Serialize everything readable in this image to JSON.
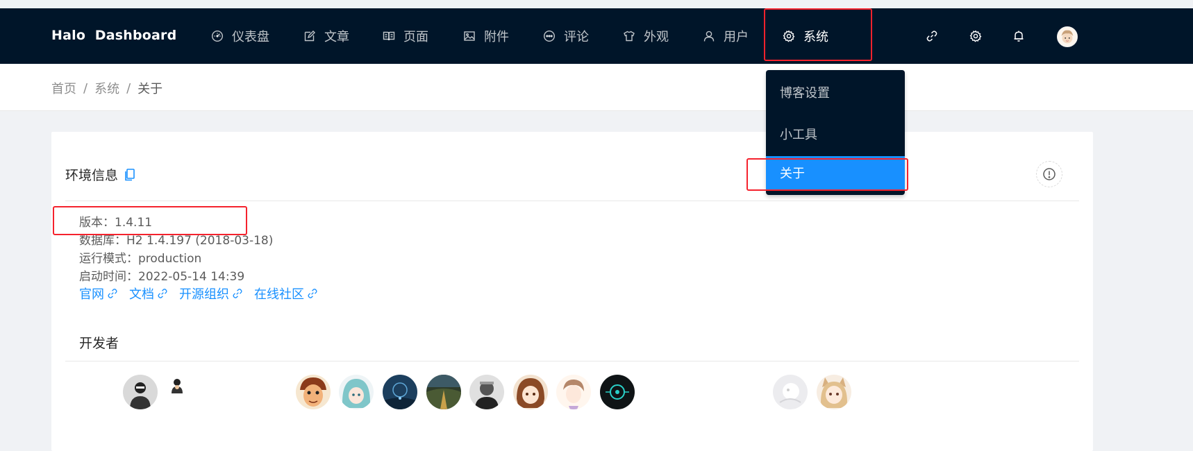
{
  "app": {
    "brand": "Halo  Dashboard"
  },
  "nav": {
    "items": [
      {
        "label": "仪表盘",
        "icon": "dashboard-icon"
      },
      {
        "label": "文章",
        "icon": "edit-icon"
      },
      {
        "label": "页面",
        "icon": "read-icon"
      },
      {
        "label": "附件",
        "icon": "picture-icon"
      },
      {
        "label": "评论",
        "icon": "message-icon"
      },
      {
        "label": "外观",
        "icon": "skin-icon"
      },
      {
        "label": "用户",
        "icon": "user-icon"
      },
      {
        "label": "系统",
        "icon": "setting-icon",
        "active": true
      }
    ],
    "right_icons": [
      "link-icon",
      "setting-icon",
      "bell-icon",
      "avatar"
    ]
  },
  "breadcrumb": {
    "items": [
      "首页",
      "系统",
      "关于"
    ],
    "separator": "/"
  },
  "dropdown": {
    "items": [
      {
        "label": "博客设置"
      },
      {
        "label": "小工具"
      },
      {
        "label": "关于",
        "selected": true
      }
    ]
  },
  "card": {
    "title": "环境信息",
    "info": [
      "版本：1.4.11",
      "数据库：H2 1.4.197 (2018-03-18)",
      "运行模式：production",
      "启动时间：2022-05-14 14:39"
    ],
    "links": [
      "官网",
      "文档",
      "开源组织",
      "在线社区"
    ],
    "developers_title": "开发者"
  },
  "colors": {
    "nav_bg": "#001529",
    "primary": "#1890ff",
    "annotation": "#f5222d"
  }
}
